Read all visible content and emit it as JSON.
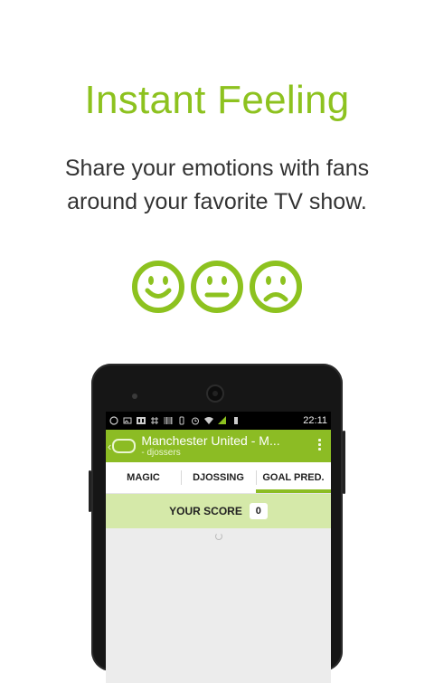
{
  "promo": {
    "headline": "Instant Feeling",
    "subline_1": "Share your emotions with fans",
    "subline_2": "around your favorite TV show.",
    "smileys": [
      "happy-face-icon",
      "neutral-face-icon",
      "sad-face-icon"
    ],
    "accent_color": "#8dc21f"
  },
  "phone": {
    "status_bar": {
      "icons": [
        "whatsapp-icon",
        "image-icon",
        "br-app-icon",
        "grid-app-icon",
        "barcode-icon",
        "vibrate-icon",
        "alarm-icon",
        "wifi-icon",
        "signal-icon",
        "battery-icon"
      ],
      "time": "22:11"
    },
    "app_bar": {
      "title": "Manchester United - M...",
      "subtitle": "- djossers",
      "color": "#8cbc24"
    },
    "tabs": [
      {
        "label": "MAGIC",
        "active": false
      },
      {
        "label": "DJOSSING",
        "active": false
      },
      {
        "label": "GOAL PRED.",
        "active": true
      }
    ],
    "score": {
      "label": "YOUR SCORE",
      "value": "0"
    }
  }
}
